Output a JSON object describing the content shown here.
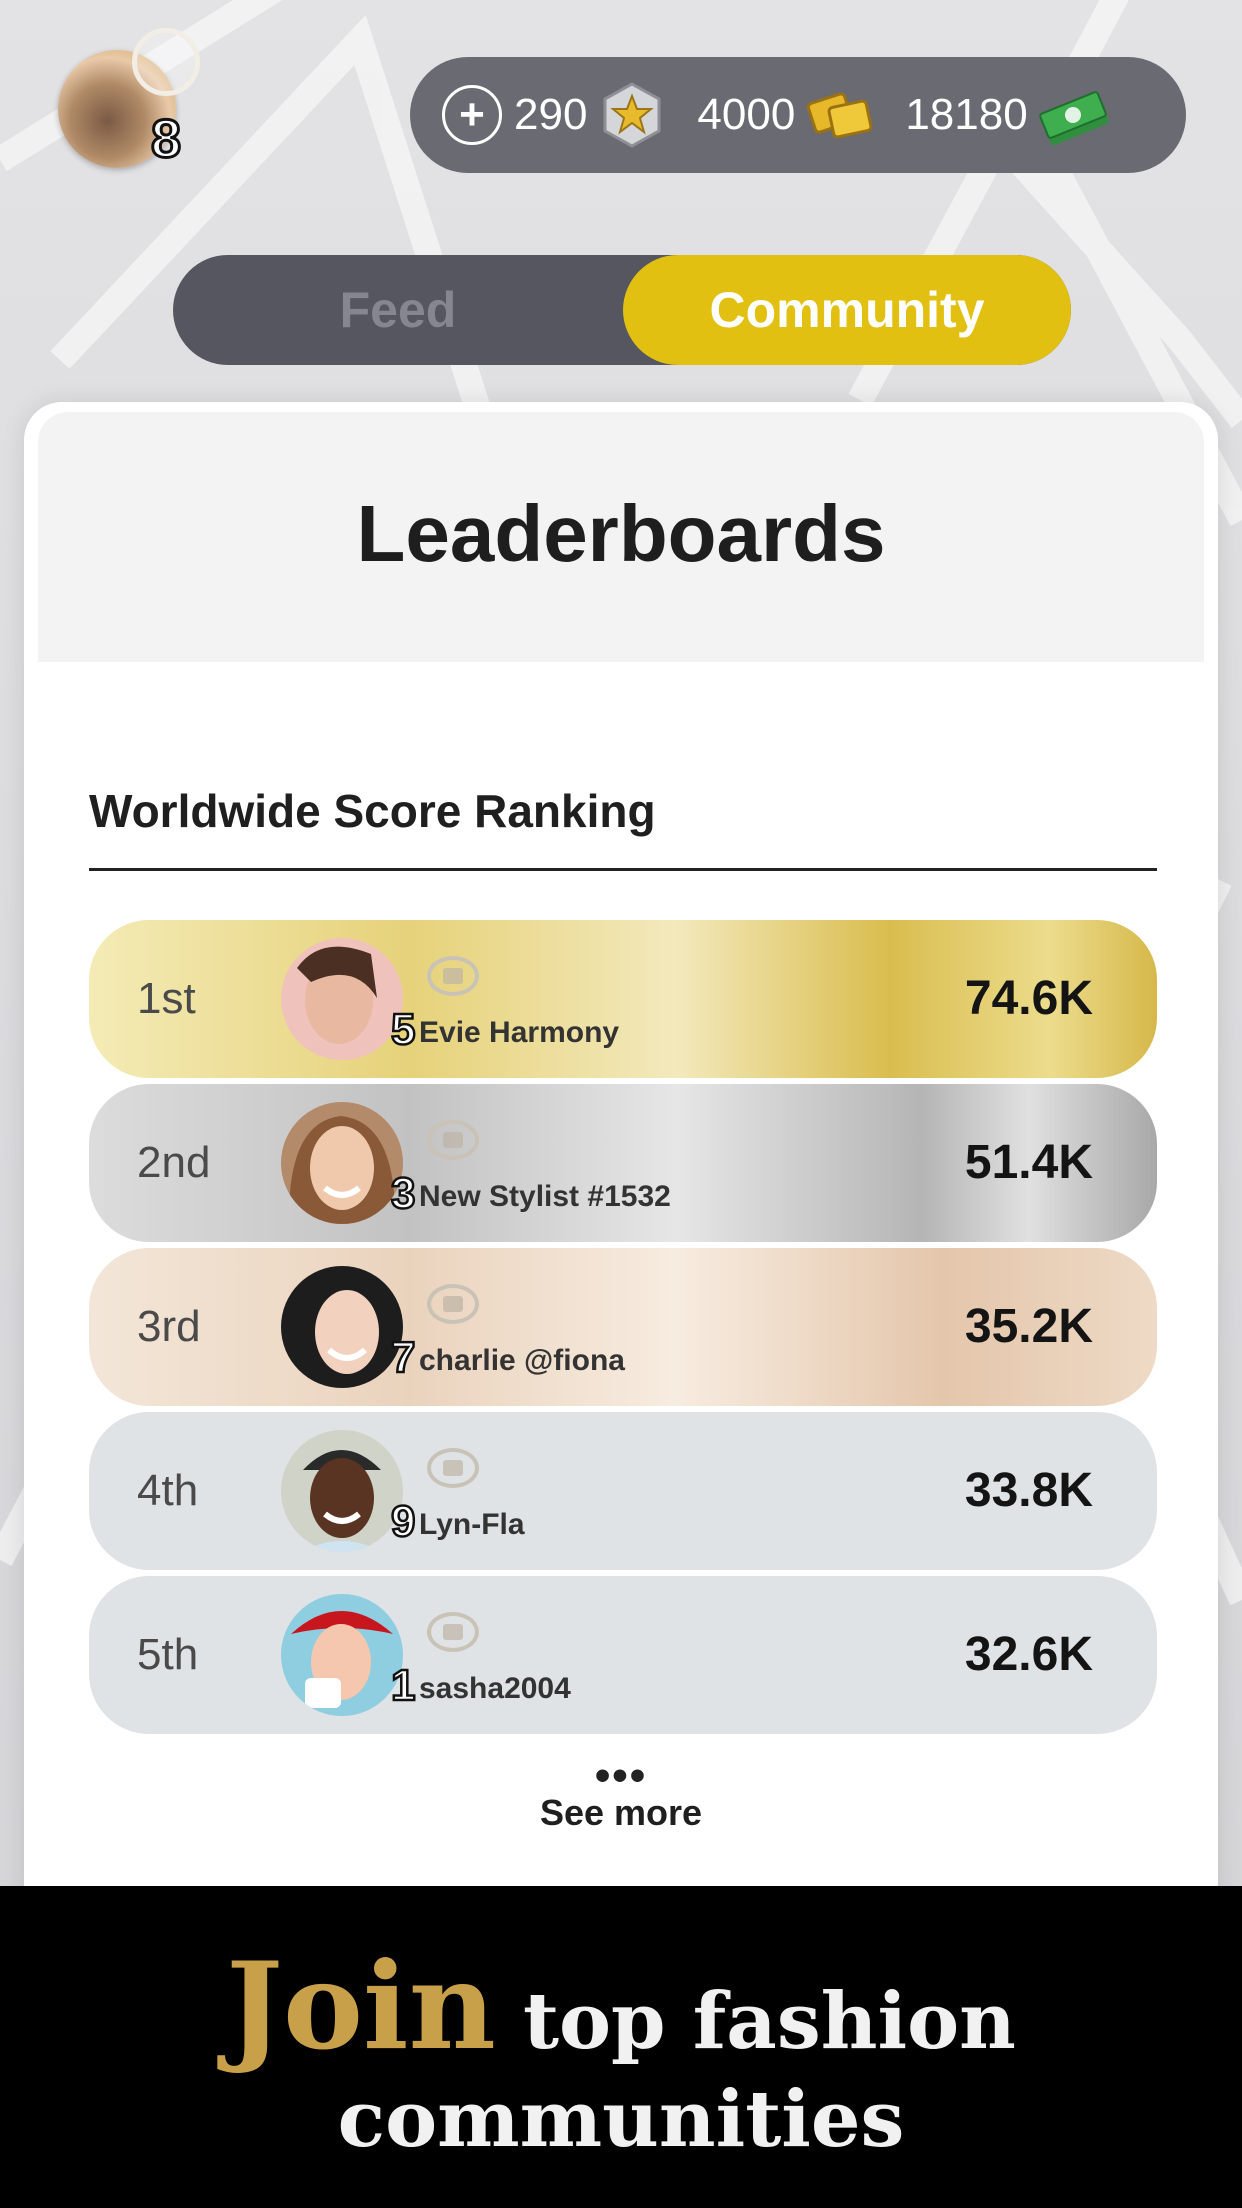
{
  "player": {
    "level": "8"
  },
  "currencies": [
    {
      "value": "290",
      "icon": "star-token-icon"
    },
    {
      "value": "4000",
      "icon": "gold-tickets-icon"
    },
    {
      "value": "18180",
      "icon": "cash-stack-icon"
    }
  ],
  "tabs": {
    "feed": "Feed",
    "community": "Community",
    "active": "Community"
  },
  "card": {
    "title": "Leaderboards",
    "section_title": "Worldwide Score Ranking"
  },
  "leaderboard": [
    {
      "rank": "1st",
      "level": "5",
      "name": "Evie Harmony",
      "score": "74.6K"
    },
    {
      "rank": "2nd",
      "level": "3",
      "name": "New Stylist #1532",
      "score": "51.4K"
    },
    {
      "rank": "3rd",
      "level": "7",
      "name": "charlie @fiona",
      "score": "35.2K"
    },
    {
      "rank": "4th",
      "level": "9",
      "name": "Lyn-Fla",
      "score": "33.8K"
    },
    {
      "rank": "5th",
      "level": "1",
      "name": "sasha2004",
      "score": "32.6K"
    }
  ],
  "see_more": {
    "dots": "•••",
    "label": "See more"
  },
  "banner": {
    "join": "Join",
    "line1_rest": "top fashion",
    "line2": "communities"
  },
  "colors": {
    "active_tab": "#e1c011",
    "gold_row": "#e6cf6a",
    "silver_row": "#b9b9b9",
    "bronze_row": "#ecd7c2",
    "plain_row": "#dfe3e6",
    "banner_gold": "#c9a04a"
  }
}
